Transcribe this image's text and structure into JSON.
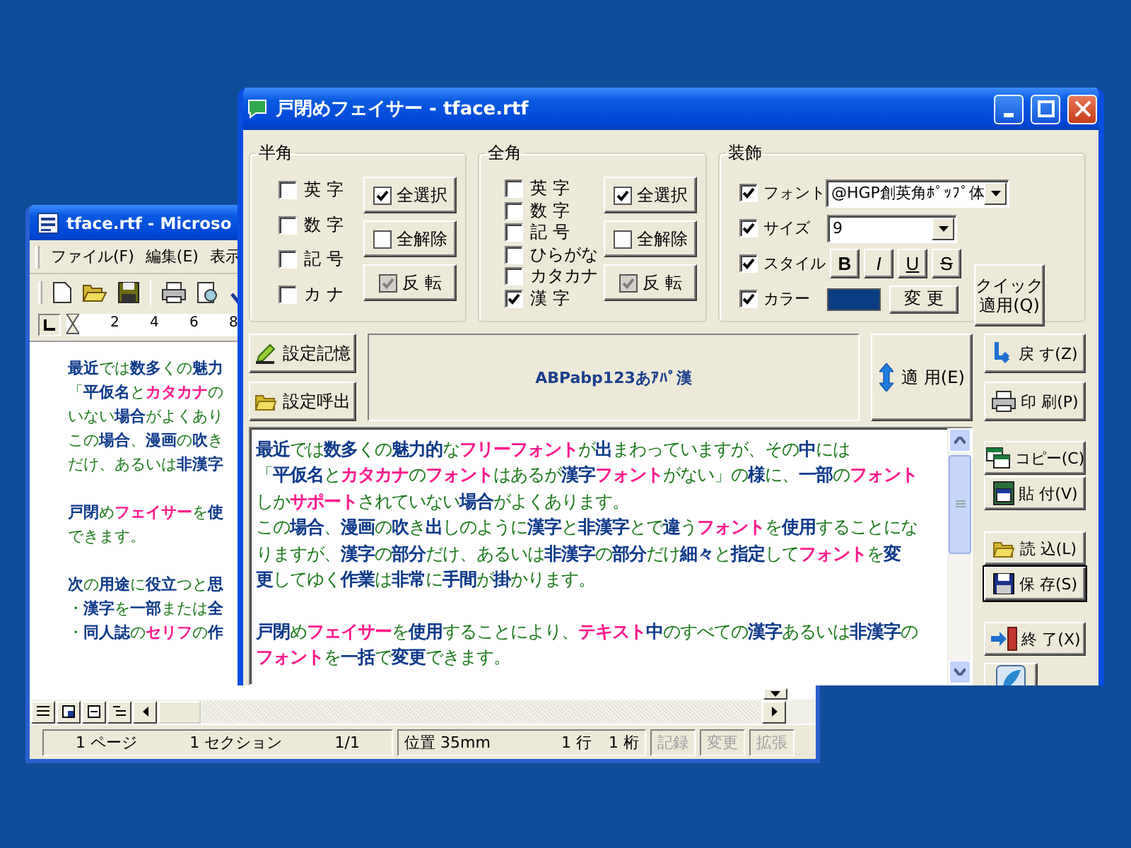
{
  "document_window": {
    "title": "tface.rtf - Microso",
    "menu": [
      "ファイル(F)",
      "編集(E)",
      "表示"
    ],
    "ruler": [
      "2",
      "4",
      "6",
      "8"
    ],
    "paragraphs": [
      {
        "lines": [
          {
            "runs": [
              {
                "text": "最近",
                "kind": "kanji"
              },
              {
                "text": "では",
                "kind": "hiragana"
              },
              {
                "text": "数多",
                "kind": "kanji"
              },
              {
                "text": "くの",
                "kind": "hiragana"
              },
              {
                "text": "魅力",
                "kind": "kanji"
              }
            ]
          },
          {
            "runs": [
              {
                "text": "「",
                "kind": "hiragana"
              },
              {
                "text": "平仮名",
                "kind": "kanji"
              },
              {
                "text": "と",
                "kind": "hiragana"
              },
              {
                "text": "カタカナ",
                "kind": "katakana"
              },
              {
                "text": "の",
                "kind": "hiragana"
              }
            ]
          },
          {
            "runs": [
              {
                "text": "いない",
                "kind": "hiragana"
              },
              {
                "text": "場合",
                "kind": "kanji"
              },
              {
                "text": "がよくあり",
                "kind": "hiragana"
              }
            ]
          },
          {
            "runs": [
              {
                "text": "この",
                "kind": "hiragana"
              },
              {
                "text": "場合",
                "kind": "kanji"
              },
              {
                "text": "、",
                "kind": "hiragana"
              },
              {
                "text": "漫画",
                "kind": "kanji"
              },
              {
                "text": "の",
                "kind": "hiragana"
              },
              {
                "text": "吹",
                "kind": "kanji"
              },
              {
                "text": "き",
                "kind": "hiragana"
              }
            ]
          },
          {
            "runs": [
              {
                "text": "だけ、あるいは",
                "kind": "hiragana"
              },
              {
                "text": "非漢字",
                "kind": "kanji"
              }
            ]
          }
        ]
      },
      {
        "lines": [
          {
            "runs": [
              {
                "text": "戸閉",
                "kind": "kanji"
              },
              {
                "text": "め",
                "kind": "hiragana"
              },
              {
                "text": "フェイサー",
                "kind": "katakana"
              },
              {
                "text": "を",
                "kind": "hiragana"
              },
              {
                "text": "使",
                "kind": "kanji"
              }
            ]
          },
          {
            "runs": [
              {
                "text": "できます。",
                "kind": "hiragana"
              }
            ]
          }
        ]
      },
      {
        "lines": [
          {
            "runs": [
              {
                "text": "次",
                "kind": "kanji"
              },
              {
                "text": "の",
                "kind": "hiragana"
              },
              {
                "text": "用途",
                "kind": "kanji"
              },
              {
                "text": "に",
                "kind": "hiragana"
              },
              {
                "text": "役立",
                "kind": "kanji"
              },
              {
                "text": "つと",
                "kind": "hiragana"
              },
              {
                "text": "思",
                "kind": "kanji"
              }
            ]
          },
          {
            "runs": [
              {
                "text": "・",
                "kind": "hiragana"
              },
              {
                "text": "漢字",
                "kind": "kanji"
              },
              {
                "text": "を",
                "kind": "hiragana"
              },
              {
                "text": "一部",
                "kind": "kanji"
              },
              {
                "text": "または",
                "kind": "hiragana"
              },
              {
                "text": "全",
                "kind": "kanji"
              }
            ]
          },
          {
            "runs": [
              {
                "text": "・",
                "kind": "hiragana"
              },
              {
                "text": "同人誌",
                "kind": "kanji"
              },
              {
                "text": "の",
                "kind": "hiragana"
              },
              {
                "text": "セリフ",
                "kind": "katakana"
              },
              {
                "text": "の",
                "kind": "hiragana"
              },
              {
                "text": "作",
                "kind": "kanji"
              }
            ]
          }
        ]
      }
    ],
    "status_bar": {
      "cells": [
        "1 ページ",
        "1 セクション",
        "1/1"
      ],
      "position_cells": [
        "位置 35mm",
        "1 行",
        "1 桁"
      ],
      "modes": [
        {
          "label": "記録",
          "enabled": false
        },
        {
          "label": "変更",
          "enabled": false
        },
        {
          "label": "拡張",
          "enabled": false
        }
      ]
    }
  },
  "app_window": {
    "title": "戸閉めフェイサー - tface.rtf",
    "groups": [
      {
        "title": "半角",
        "options": [
          {
            "label": "英 字",
            "checked": false
          },
          {
            "label": "数 字",
            "checked": false
          },
          {
            "label": "記 号",
            "checked": false
          },
          {
            "label": "カ ナ",
            "checked": false
          }
        ],
        "buttons": [
          {
            "label": "全選択",
            "kind": "checked"
          },
          {
            "label": "全解除",
            "kind": "unchecked"
          },
          {
            "label": "反 転",
            "kind": "grayed"
          }
        ]
      },
      {
        "title": "全角",
        "options": [
          {
            "label": "英 字",
            "checked": false
          },
          {
            "label": "数 字",
            "checked": false
          },
          {
            "label": "記 号",
            "checked": false
          },
          {
            "label": "ひらがな",
            "checked": false
          },
          {
            "label": "カタカナ",
            "checked": false
          },
          {
            "label": "漢 字",
            "checked": true
          }
        ],
        "buttons": [
          {
            "label": "全選択",
            "kind": "checked"
          },
          {
            "label": "全解除",
            "kind": "unchecked"
          },
          {
            "label": "反 転",
            "kind": "grayed"
          }
        ]
      }
    ],
    "decoration": {
      "title": "装飾",
      "font": {
        "label": "フォント",
        "checked": true,
        "value": "@HGP創英角ﾎﾟｯﾌﾟ体"
      },
      "size": {
        "label": "サイズ",
        "checked": true,
        "value": "9"
      },
      "style": {
        "label": "スタイル",
        "checked": true,
        "buttons": [
          {
            "label": "B",
            "kind": "bold"
          },
          {
            "label": "I",
            "kind": "italic"
          },
          {
            "label": "U",
            "kind": "underline"
          },
          {
            "label": "S",
            "kind": "strike"
          }
        ]
      },
      "color": {
        "label": "カラー",
        "checked": true,
        "color": "#0a3d84",
        "button": "変 更"
      },
      "quick_button": [
        "クイック",
        "適用(Q)"
      ]
    },
    "preset_buttons": [
      "設定記憶",
      "設定呼出"
    ],
    "preview": "ABPabp123あｱﾊﾟ漢",
    "apply_button": "適 用(E)",
    "side_buttons": [
      {
        "label": "戻 す(Z)",
        "focused": false
      },
      {
        "label": "印 刷(P)",
        "focused": false
      },
      {
        "label": "コピー(C)",
        "focused": false
      },
      {
        "label": "貼 付(V)",
        "focused": false
      },
      {
        "label": "読 込(L)",
        "focused": false
      },
      {
        "label": "保 存(S)",
        "focused": true
      },
      {
        "label": "終 了(X)",
        "focused": false
      }
    ],
    "text_lines": [
      {
        "runs": [
          {
            "text": "最近",
            "kind": "kanji"
          },
          {
            "text": "では",
            "kind": "hiragana"
          },
          {
            "text": "数多",
            "kind": "kanji"
          },
          {
            "text": "くの",
            "kind": "hiragana"
          },
          {
            "text": "魅力的",
            "kind": "kanji"
          },
          {
            "text": "な",
            "kind": "hiragana"
          },
          {
            "text": "フリーフォント",
            "kind": "katakana"
          },
          {
            "text": "が",
            "kind": "hiragana"
          },
          {
            "text": "出",
            "kind": "kanji"
          },
          {
            "text": "まわっていますが、その",
            "kind": "hiragana"
          },
          {
            "text": "中",
            "kind": "kanji"
          },
          {
            "text": "には",
            "kind": "hiragana"
          }
        ]
      },
      {
        "runs": [
          {
            "text": "「",
            "kind": "hiragana"
          },
          {
            "text": "平仮名",
            "kind": "kanji"
          },
          {
            "text": "と",
            "kind": "hiragana"
          },
          {
            "text": "カタカナ",
            "kind": "katakana"
          },
          {
            "text": "の",
            "kind": "hiragana"
          },
          {
            "text": "フォント",
            "kind": "katakana"
          },
          {
            "text": "はあるが",
            "kind": "hiragana"
          },
          {
            "text": "漢字",
            "kind": "kanji"
          },
          {
            "text": "フォント",
            "kind": "katakana"
          },
          {
            "text": "がない」の",
            "kind": "hiragana"
          },
          {
            "text": "様",
            "kind": "kanji"
          },
          {
            "text": "に、",
            "kind": "hiragana"
          },
          {
            "text": "一部",
            "kind": "kanji"
          },
          {
            "text": "の",
            "kind": "hiragana"
          },
          {
            "text": "フォント",
            "kind": "katakana"
          }
        ]
      },
      {
        "runs": [
          {
            "text": "しか",
            "kind": "hiragana"
          },
          {
            "text": "サポート",
            "kind": "katakana"
          },
          {
            "text": "されていない",
            "kind": "hiragana"
          },
          {
            "text": "場合",
            "kind": "kanji"
          },
          {
            "text": "がよくあります。",
            "kind": "hiragana"
          }
        ]
      },
      {
        "runs": [
          {
            "text": "この",
            "kind": "hiragana"
          },
          {
            "text": "場合",
            "kind": "kanji"
          },
          {
            "text": "、",
            "kind": "hiragana"
          },
          {
            "text": "漫画",
            "kind": "kanji"
          },
          {
            "text": "の",
            "kind": "hiragana"
          },
          {
            "text": "吹",
            "kind": "kanji"
          },
          {
            "text": "き",
            "kind": "hiragana"
          },
          {
            "text": "出",
            "kind": "kanji"
          },
          {
            "text": "しのように",
            "kind": "hiragana"
          },
          {
            "text": "漢字",
            "kind": "kanji"
          },
          {
            "text": "と",
            "kind": "hiragana"
          },
          {
            "text": "非漢字",
            "kind": "kanji"
          },
          {
            "text": "とで",
            "kind": "hiragana"
          },
          {
            "text": "違",
            "kind": "kanji"
          },
          {
            "text": "う",
            "kind": "hiragana"
          },
          {
            "text": "フォント",
            "kind": "katakana"
          },
          {
            "text": "を",
            "kind": "hiragana"
          },
          {
            "text": "使用",
            "kind": "kanji"
          },
          {
            "text": "することにな",
            "kind": "hiragana"
          }
        ]
      },
      {
        "runs": [
          {
            "text": "りますが、",
            "kind": "hiragana"
          },
          {
            "text": "漢字",
            "kind": "kanji"
          },
          {
            "text": "の",
            "kind": "hiragana"
          },
          {
            "text": "部分",
            "kind": "kanji"
          },
          {
            "text": "だけ、あるいは",
            "kind": "hiragana"
          },
          {
            "text": "非漢字",
            "kind": "kanji"
          },
          {
            "text": "の",
            "kind": "hiragana"
          },
          {
            "text": "部分",
            "kind": "kanji"
          },
          {
            "text": "だけ",
            "kind": "hiragana"
          },
          {
            "text": "細々",
            "kind": "kanji"
          },
          {
            "text": "と",
            "kind": "hiragana"
          },
          {
            "text": "指定",
            "kind": "kanji"
          },
          {
            "text": "して",
            "kind": "hiragana"
          },
          {
            "text": "フォント",
            "kind": "katakana"
          },
          {
            "text": "を",
            "kind": "hiragana"
          },
          {
            "text": "変",
            "kind": "kanji"
          }
        ]
      },
      {
        "runs": [
          {
            "text": "更",
            "kind": "kanji"
          },
          {
            "text": "してゆく",
            "kind": "hiragana"
          },
          {
            "text": "作業",
            "kind": "kanji"
          },
          {
            "text": "は",
            "kind": "hiragana"
          },
          {
            "text": "非常",
            "kind": "kanji"
          },
          {
            "text": "に",
            "kind": "hiragana"
          },
          {
            "text": "手間",
            "kind": "kanji"
          },
          {
            "text": "が",
            "kind": "hiragana"
          },
          {
            "text": "掛",
            "kind": "kanji"
          },
          {
            "text": "かります。",
            "kind": "hiragana"
          }
        ]
      },
      {
        "space_before": true,
        "runs": [
          {
            "text": "戸閉",
            "kind": "kanji"
          },
          {
            "text": "め",
            "kind": "hiragana"
          },
          {
            "text": "フェイサー",
            "kind": "katakana"
          },
          {
            "text": "を",
            "kind": "hiragana"
          },
          {
            "text": "使用",
            "kind": "kanji"
          },
          {
            "text": "することにより、",
            "kind": "hiragana"
          },
          {
            "text": "テキスト",
            "kind": "katakana"
          },
          {
            "text": "中",
            "kind": "kanji"
          },
          {
            "text": "のすべての",
            "kind": "hiragana"
          },
          {
            "text": "漢字",
            "kind": "kanji"
          },
          {
            "text": "あるいは",
            "kind": "hiragana"
          },
          {
            "text": "非漢字",
            "kind": "kanji"
          },
          {
            "text": "の",
            "kind": "hiragana"
          }
        ]
      },
      {
        "runs": [
          {
            "text": "フォント",
            "kind": "katakana"
          },
          {
            "text": "を",
            "kind": "hiragana"
          },
          {
            "text": "一括",
            "kind": "kanji"
          },
          {
            "text": "で",
            "kind": "hiragana"
          },
          {
            "text": "変更",
            "kind": "kanji"
          },
          {
            "text": "できます。",
            "kind": "hiragana"
          }
        ]
      }
    ]
  }
}
